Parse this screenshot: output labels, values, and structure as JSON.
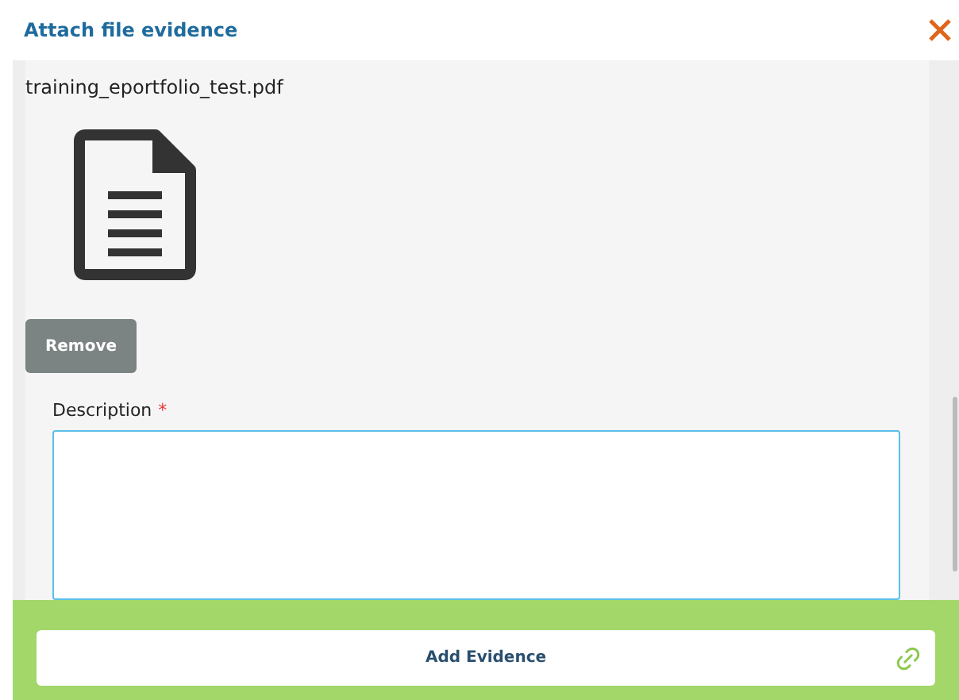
{
  "dialog": {
    "title": "Attach file evidence"
  },
  "file": {
    "name": "training_eportfolio_test.pdf"
  },
  "remove_button": {
    "label": "Remove"
  },
  "description": {
    "label": "Description",
    "required_mark": "*"
  },
  "footer": {
    "button": "Add Evidence"
  }
}
